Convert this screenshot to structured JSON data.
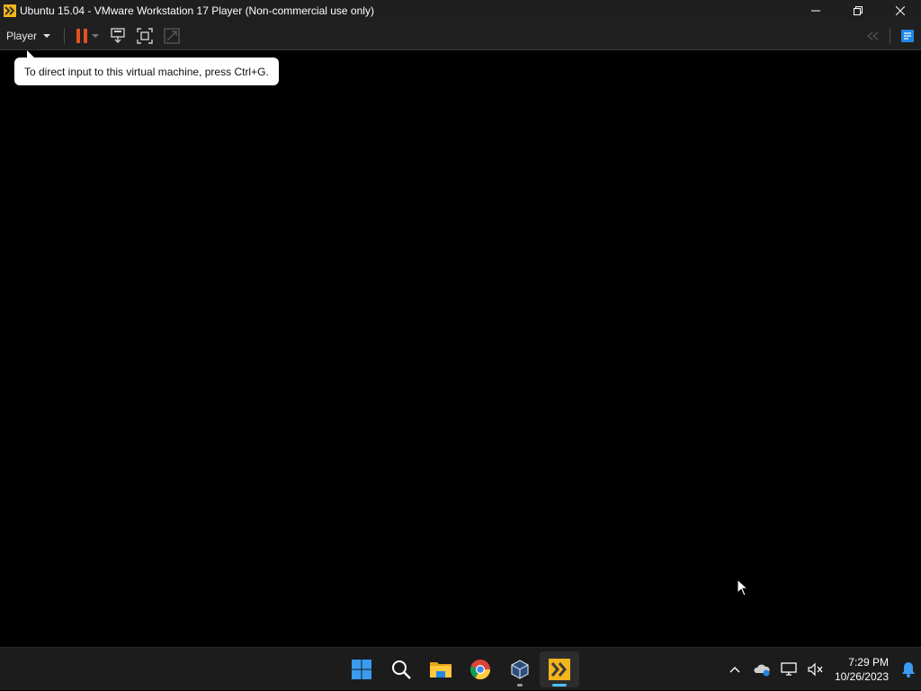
{
  "window": {
    "title": "Ubuntu 15.04 - VMware Workstation 17 Player (Non-commercial use only)",
    "app_icon": "vmware-icon",
    "controls": [
      "minimize-icon",
      "restore-icon",
      "close-icon"
    ]
  },
  "toolbar": {
    "player_menu_label": "Player",
    "buttons": [
      "pause-icon",
      "send-ctrl-alt-del-icon",
      "fullscreen-icon",
      "unity-icon"
    ],
    "right_buttons": [
      "back-icon",
      "library-icon"
    ],
    "accent_color": "#e0531f"
  },
  "tooltip": {
    "text": "To direct input to this virtual machine, press Ctrl+G."
  },
  "taskbar": {
    "apps": [
      "windows-start-icon",
      "search-icon",
      "file-explorer-icon",
      "chrome-icon",
      "virtualbox-icon",
      "vmware-player-icon"
    ],
    "tray_icons": [
      "chevron-up-icon",
      "onedrive-icon",
      "network-icon",
      "volume-muted-icon"
    ],
    "time": "7:29 PM",
    "date": "10/26/2023",
    "notification_icon": "bell-icon"
  }
}
